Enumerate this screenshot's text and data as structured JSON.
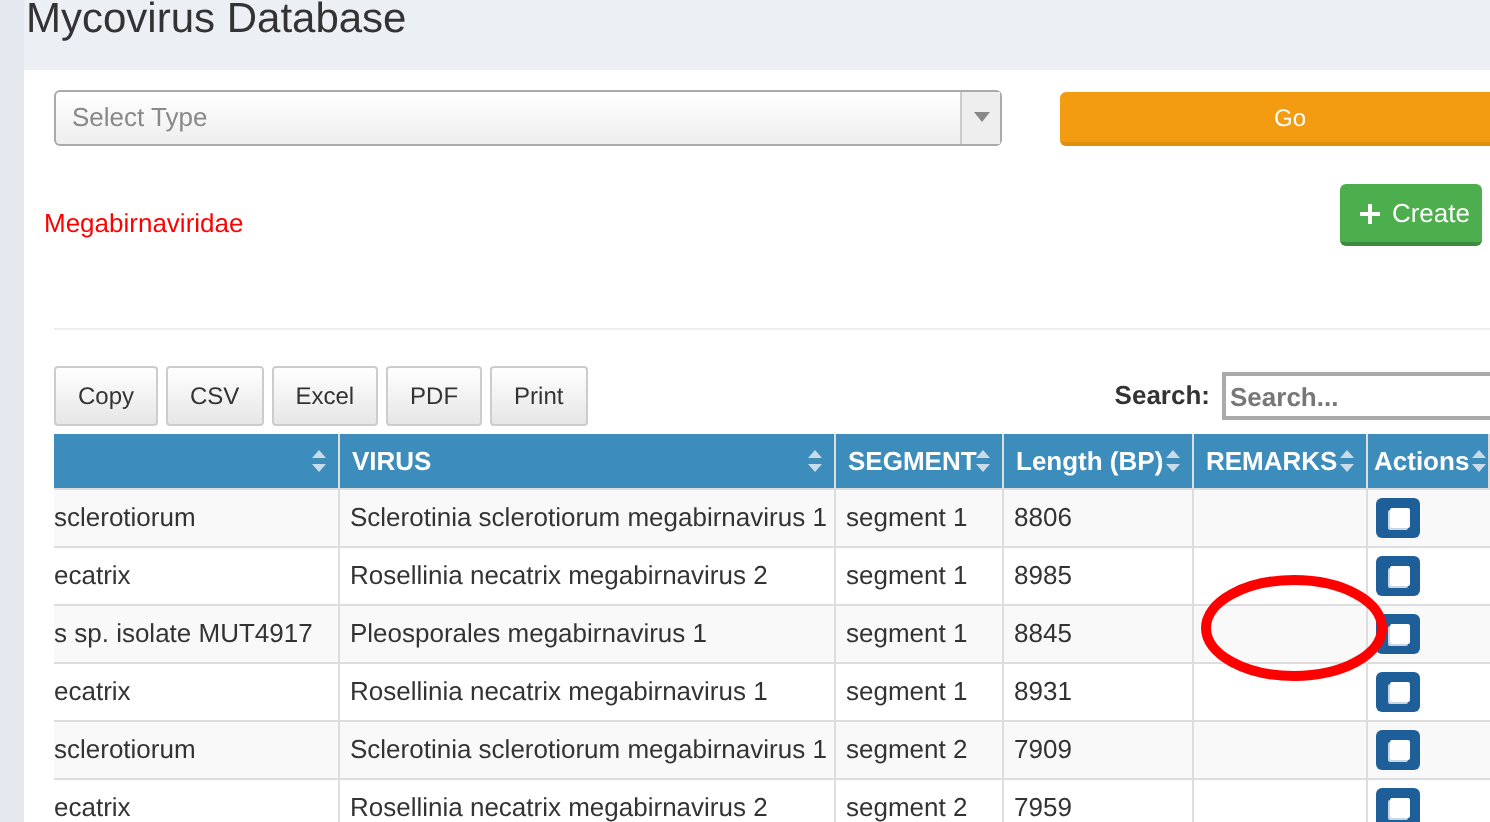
{
  "page_title": "Mycovirus Database",
  "type_select": {
    "placeholder": "Select Type"
  },
  "go_button": "Go",
  "family_label": "Megabirnaviridae",
  "create_button": "Create",
  "export_buttons": [
    "Copy",
    "CSV",
    "Excel",
    "PDF",
    "Print"
  ],
  "search": {
    "label": "Search:",
    "placeholder": "Search..."
  },
  "table": {
    "columns": [
      "",
      "VIRUS",
      "SEGMENT",
      "Length (BP)",
      "REMARKS",
      "Actions"
    ],
    "rows": [
      {
        "column_1": "sclerotiorum",
        "virus": "Sclerotinia sclerotiorum megabirnavirus 1",
        "segment": "segment 1",
        "length": "8806",
        "remarks": ""
      },
      {
        "column_1": "ecatrix",
        "virus": "Rosellinia necatrix megabirnavirus 2",
        "segment": "segment 1",
        "length": "8985",
        "remarks": ""
      },
      {
        "column_1": "s sp. isolate MUT4917",
        "virus": "Pleosporales megabirnavirus 1",
        "segment": "segment 1",
        "length": "8845",
        "remarks": ""
      },
      {
        "column_1": "ecatrix",
        "virus": "Rosellinia necatrix megabirnavirus 1",
        "segment": "segment 1",
        "length": "8931",
        "remarks": ""
      },
      {
        "column_1": "sclerotiorum",
        "virus": "Sclerotinia sclerotiorum megabirnavirus 1",
        "segment": "segment 2",
        "length": "7909",
        "remarks": ""
      },
      {
        "column_1": "ecatrix",
        "virus": "Rosellinia necatrix megabirnavirus 2",
        "segment": "segment 2",
        "length": "7959",
        "remarks": ""
      }
    ]
  }
}
